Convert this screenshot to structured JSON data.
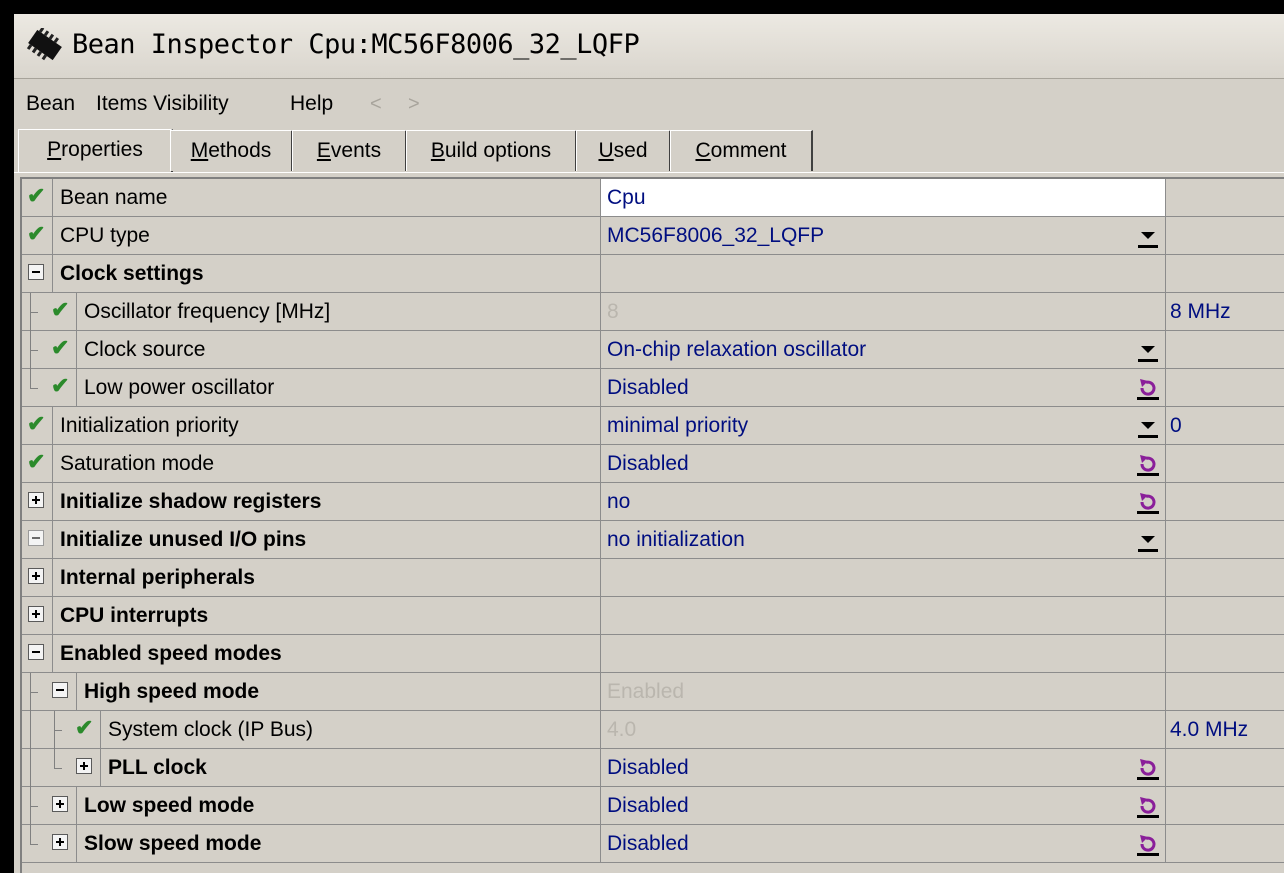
{
  "window": {
    "title": "Bean Inspector Cpu:MC56F8006_32_LQFP",
    "icon": "chip-icon"
  },
  "menu": {
    "items": [
      "Bean",
      "Items Visibility",
      "Help"
    ],
    "back_arrow": "<",
    "forward_arrow": ">"
  },
  "tabs": [
    {
      "label": "Properties",
      "underline": "P",
      "rest": "roperties",
      "active": true
    },
    {
      "label": "Methods",
      "underline": "M",
      "rest": "ethods"
    },
    {
      "label": "Events",
      "underline": "E",
      "rest": "vents"
    },
    {
      "label": "Build options",
      "underline": "B",
      "rest": "uild options"
    },
    {
      "label": "Used",
      "underline": "U",
      "rest": "sed"
    },
    {
      "label": "Comment",
      "underline": "C",
      "rest": "omment"
    }
  ],
  "colors": {
    "value_text": "#000e80",
    "disabled_text": "#bab6ae",
    "check": "#2b8a2b",
    "reset_icon": "#8a1f9a",
    "window_bg": "#d4d0c8"
  },
  "properties": [
    {
      "name": "Bean name",
      "value": "Cpu",
      "extra": "",
      "indent": 0,
      "marker": "check",
      "bold": false,
      "control": "none",
      "value_style": "editable",
      "value_bg": "white"
    },
    {
      "name": "CPU type",
      "value": "MC56F8006_32_LQFP",
      "extra": "",
      "indent": 0,
      "marker": "check",
      "bold": false,
      "control": "dropdown",
      "value_style": "normal"
    },
    {
      "name": "Clock settings",
      "value": "",
      "extra": "",
      "indent": 0,
      "marker": "collapse",
      "bold": true,
      "control": "none",
      "value_style": "normal"
    },
    {
      "name": "Oscillator frequency [MHz]",
      "value": "8",
      "extra": "8 MHz",
      "indent": 1,
      "marker": "check",
      "bold": false,
      "control": "none",
      "value_style": "disabled"
    },
    {
      "name": "Clock source",
      "value": "On-chip relaxation oscillator",
      "extra": "",
      "indent": 1,
      "marker": "check",
      "bold": false,
      "control": "dropdown",
      "value_style": "normal"
    },
    {
      "name": "Low power oscillator",
      "value": "Disabled",
      "extra": "",
      "indent": 1,
      "marker": "check",
      "bold": false,
      "control": "reset",
      "value_style": "normal",
      "last": true
    },
    {
      "name": "Initialization priority",
      "value": "minimal priority",
      "extra": "0",
      "indent": 0,
      "marker": "check",
      "bold": false,
      "control": "dropdown",
      "value_style": "normal"
    },
    {
      "name": "Saturation mode",
      "value": "Disabled",
      "extra": "",
      "indent": 0,
      "marker": "check",
      "bold": false,
      "control": "reset",
      "value_style": "normal"
    },
    {
      "name": "Initialize shadow registers",
      "value": "no",
      "extra": "",
      "indent": 0,
      "marker": "expand",
      "bold": true,
      "control": "reset",
      "value_style": "normal"
    },
    {
      "name": "Initialize unused I/O pins",
      "value": "no initialization",
      "extra": "",
      "indent": 0,
      "marker": "collapse-light",
      "bold": true,
      "control": "dropdown",
      "value_style": "normal"
    },
    {
      "name": "Internal peripherals",
      "value": "",
      "extra": "",
      "indent": 0,
      "marker": "expand",
      "bold": true,
      "control": "none",
      "value_style": "normal"
    },
    {
      "name": "CPU interrupts",
      "value": "",
      "extra": "",
      "indent": 0,
      "marker": "expand",
      "bold": true,
      "control": "none",
      "value_style": "normal"
    },
    {
      "name": "Enabled speed modes",
      "value": "",
      "extra": "",
      "indent": 0,
      "marker": "collapse",
      "bold": true,
      "control": "none",
      "value_style": "normal"
    },
    {
      "name": "High speed mode",
      "value": "Enabled",
      "extra": "",
      "indent": 1,
      "marker": "collapse",
      "bold": true,
      "control": "none",
      "value_style": "disabled"
    },
    {
      "name": "System clock (IP Bus)",
      "value": "4.0",
      "extra": "4.0 MHz",
      "indent": 2,
      "marker": "check",
      "bold": false,
      "control": "none",
      "value_style": "disabled"
    },
    {
      "name": "PLL clock",
      "value": "Disabled",
      "extra": "",
      "indent": 2,
      "marker": "expand",
      "bold": true,
      "control": "reset",
      "value_style": "normal",
      "last": true
    },
    {
      "name": "Low speed mode",
      "value": "Disabled",
      "extra": "",
      "indent": 1,
      "marker": "expand",
      "bold": true,
      "control": "reset",
      "value_style": "normal"
    },
    {
      "name": "Slow speed mode",
      "value": "Disabled",
      "extra": "",
      "indent": 1,
      "marker": "expand",
      "bold": true,
      "control": "reset",
      "value_style": "normal",
      "last": true
    }
  ]
}
